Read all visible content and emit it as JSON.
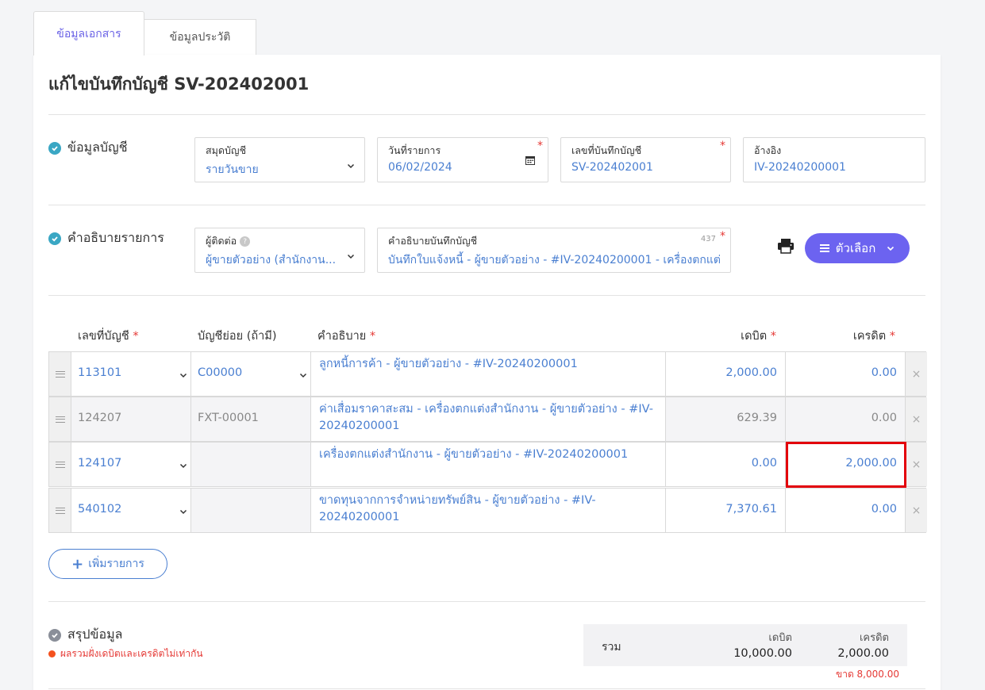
{
  "tabs": [
    {
      "label": "ข้อมูลเอกสาร",
      "active": true
    },
    {
      "label": "ข้อมูลประวัติ",
      "active": false
    }
  ],
  "page_title": "แก้ไขบันทึกบัญชี SV-202402001",
  "account_info": {
    "section_title": "ข้อมูลบัญชี",
    "journal_book": {
      "label": "สมุดบัญชี",
      "value": "รายวันขาย"
    },
    "transaction_date": {
      "label": "วันที่รายการ",
      "value": "06/02/2024",
      "required": true
    },
    "journal_number": {
      "label": "เลขที่บันทึกบัญชี",
      "value": "SV-202402001",
      "required": true
    },
    "reference": {
      "label": "อ้างอิง",
      "value": "IV-20240200001"
    }
  },
  "transaction_desc": {
    "section_title": "คำอธิบายรายการ",
    "contact": {
      "label": "ผู้ติดต่อ",
      "value": "ผู้ขายตัวอย่าง (สำนักงาน..."
    },
    "description": {
      "label": "คำอธิบายบันทึกบัญชี",
      "counter": "437",
      "value": "บันทึกใบแจ้งหนี้ - ผู้ขายตัวอย่าง - #IV-20240200001 - เครื่องตกแต่งสำ"
    },
    "options_button": "ตัวเลือก",
    "icons": {
      "print": "print-icon",
      "menu": "menu-icon"
    }
  },
  "table": {
    "headers": {
      "account_no": "เลขที่บัญชี",
      "sub_account": "บัญชีย่อย (ถ้ามี)",
      "description": "คำอธิบาย",
      "debit": "เดบิต",
      "credit": "เครดิต",
      "required_mark": "*"
    },
    "rows": [
      {
        "account": "113101",
        "sub": "C00000",
        "desc": "ลูกหนี้การค้า - ผู้ขายตัวอย่าง - #IV-20240200001",
        "debit": "2,000.00",
        "credit": "0.00",
        "editable": true
      },
      {
        "account": "124207",
        "sub": "FXT-00001",
        "desc": "ค่าเสื่อมราคาสะสม - เครื่องตกแต่งสำนักงาน - ผู้ขายตัวอย่าง - #IV-20240200001",
        "debit": "629.39",
        "credit": "0.00",
        "editable": false
      },
      {
        "account": "124107",
        "sub": "",
        "desc": "เครื่องตกแต่งสำนักงาน - ผู้ขายตัวอย่าง - #IV-20240200001",
        "debit": "0.00",
        "credit": "2,000.00",
        "editable": true
      },
      {
        "account": "540102",
        "sub": "",
        "desc": "ขาดทุนจากการจำหน่ายทรัพย์สิน - ผู้ขายตัวอย่าง - #IV-20240200001",
        "debit": "7,370.61",
        "credit": "0.00",
        "editable": true
      }
    ],
    "add_button": "เพิ่มรายการ",
    "delete_symbol": "×"
  },
  "summary": {
    "section_title": "สรุปข้อมูล",
    "warning": "ผลรวมฝั่งเดบิตและเครดิตไม่เท่ากัน",
    "total_label": "รวม",
    "debit_label": "เดบิต",
    "credit_label": "เครดิต",
    "debit_total": "10,000.00",
    "credit_total": "2,000.00",
    "difference": "ขาด 8,000.00"
  },
  "colors": {
    "accent": "#6c63f0",
    "link": "#4a7fd1",
    "check": "#3aa7c4",
    "error": "#e53935",
    "highlight": "#e3000b"
  }
}
